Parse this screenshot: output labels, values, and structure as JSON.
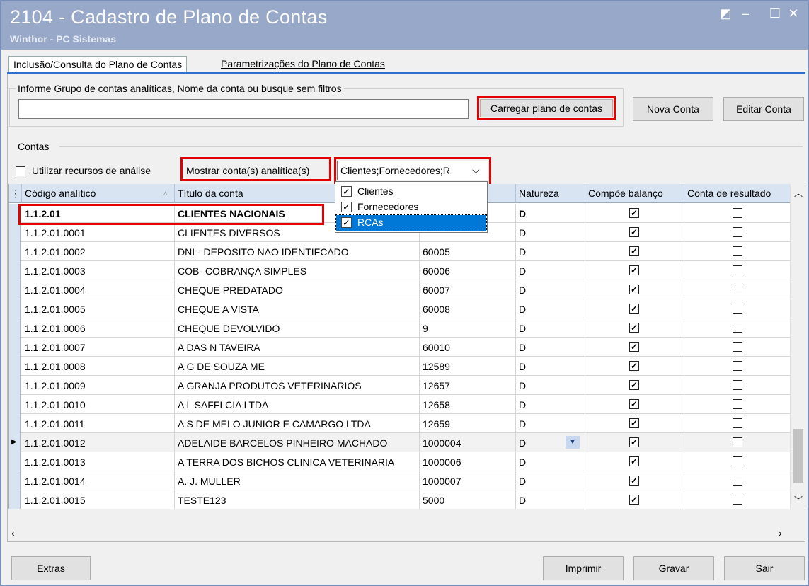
{
  "window": {
    "title": "2104 - Cadastro de Plano de Contas",
    "subtitle": "Winthor - PC Sistemas",
    "buttons": [
      "◩",
      "–",
      "☐",
      "✕"
    ]
  },
  "tabs": [
    {
      "label": "Inclusão/Consulta do Plano de Contas",
      "active": true
    },
    {
      "label": "Parametrizações do Plano de Contas",
      "active": false
    }
  ],
  "search": {
    "group_label": "Informe Grupo de contas analíticas, Nome da conta ou busque sem filtros",
    "value": "",
    "load_button": "Carregar plano de contas",
    "new_button": "Nova Conta",
    "edit_button": "Editar Conta"
  },
  "contas": {
    "group_label": "Contas",
    "analysis_checkbox_label": "Utilizar recursos de análise",
    "analysis_checked": false,
    "show_label": "Mostrar conta(s) analítica(s)",
    "combo_value": "Clientes;Fornecedores;R",
    "dropdown_options": [
      {
        "label": "Clientes",
        "checked": true,
        "selected": false
      },
      {
        "label": "Fornecedores",
        "checked": true,
        "selected": false
      },
      {
        "label": "RCAs",
        "checked": true,
        "selected": true
      }
    ]
  },
  "grid": {
    "headers": [
      "Código analítico",
      "Título da conta",
      "",
      "Natureza",
      "Compõe balanço",
      "Conta de resultado"
    ],
    "rows": [
      {
        "code": "1.1.2.01",
        "title": "CLIENTES NACIONAIS",
        "ref": "",
        "nat": "D",
        "balanco": true,
        "resultado": false,
        "bold": true
      },
      {
        "code": "1.1.2.01.0001",
        "title": "CLIENTES DIVERSOS",
        "ref": "",
        "nat": "D",
        "balanco": true,
        "resultado": false
      },
      {
        "code": "1.1.2.01.0002",
        "title": "DNI - DEPOSITO NAO IDENTIFCADO",
        "ref": "60005",
        "nat": "D",
        "balanco": true,
        "resultado": false
      },
      {
        "code": "1.1.2.01.0003",
        "title": "COB- COBRANÇA SIMPLES",
        "ref": "60006",
        "nat": "D",
        "balanco": true,
        "resultado": false
      },
      {
        "code": "1.1.2.01.0004",
        "title": "CHEQUE PREDATADO",
        "ref": "60007",
        "nat": "D",
        "balanco": true,
        "resultado": false
      },
      {
        "code": "1.1.2.01.0005",
        "title": "CHEQUE A VISTA",
        "ref": "60008",
        "nat": "D",
        "balanco": true,
        "resultado": false
      },
      {
        "code": "1.1.2.01.0006",
        "title": "CHEQUE DEVOLVIDO",
        "ref": "9",
        "nat": "D",
        "balanco": true,
        "resultado": false
      },
      {
        "code": "1.1.2.01.0007",
        "title": "A DAS N TAVEIRA",
        "ref": "60010",
        "nat": "D",
        "balanco": true,
        "resultado": false
      },
      {
        "code": "1.1.2.01.0008",
        "title": "A G DE SOUZA ME",
        "ref": "12589",
        "nat": "D",
        "balanco": true,
        "resultado": false
      },
      {
        "code": "1.1.2.01.0009",
        "title": "A GRANJA PRODUTOS VETERINARIOS",
        "ref": "12657",
        "nat": "D",
        "balanco": true,
        "resultado": false
      },
      {
        "code": "1.1.2.01.0010",
        "title": "A L SAFFI CIA LTDA",
        "ref": "12658",
        "nat": "D",
        "balanco": true,
        "resultado": false
      },
      {
        "code": "1.1.2.01.0011",
        "title": "A S DE MELO JUNIOR E CAMARGO LTDA",
        "ref": "12659",
        "nat": "D",
        "balanco": true,
        "resultado": false
      },
      {
        "code": "1.1.2.01.0012",
        "title": "ADELAIDE BARCELOS PINHEIRO MACHADO",
        "ref": "1000004",
        "nat": "D",
        "balanco": true,
        "resultado": false,
        "current": true
      },
      {
        "code": "1.1.2.01.0013",
        "title": "A TERRA DOS BICHOS CLINICA VETERINARIA",
        "ref": "1000006",
        "nat": "D",
        "balanco": true,
        "resultado": false
      },
      {
        "code": "1.1.2.01.0014",
        "title": "A. J. MULLER",
        "ref": "1000007",
        "nat": "D",
        "balanco": true,
        "resultado": false
      },
      {
        "code": "1.1.2.01.0015",
        "title": "TESTE123",
        "ref": "5000",
        "nat": "D",
        "balanco": true,
        "resultado": false
      }
    ]
  },
  "footer": {
    "extras": "Extras",
    "print": "Imprimir",
    "save": "Gravar",
    "exit": "Sair"
  },
  "colors": {
    "titlebar": "#98a8c9",
    "header": "#d9e4f2",
    "highlight": "#e30000",
    "selection": "#0078d7"
  }
}
